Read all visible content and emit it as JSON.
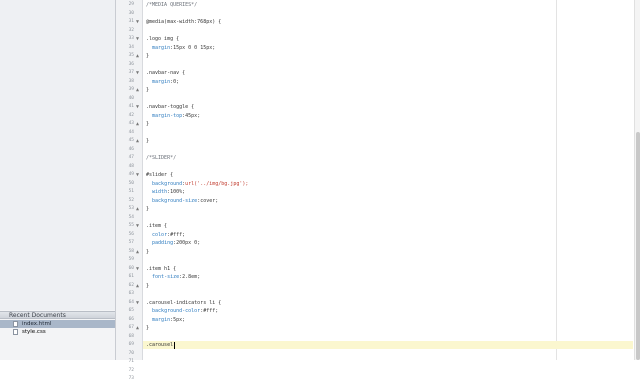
{
  "sidebar": {
    "header": "Recent Documents",
    "documents": [
      {
        "name": "index.html",
        "selected": true
      },
      {
        "name": "style.css",
        "selected": false
      }
    ]
  },
  "editor": {
    "lines": [
      {
        "n": "29",
        "text": "/*MEDIA QUERIES*/",
        "kind": "comment"
      },
      {
        "n": "30",
        "text": ""
      },
      {
        "n": "31",
        "text": "@media(max-width:768px) {",
        "fold": "▼"
      },
      {
        "n": "32",
        "text": ""
      },
      {
        "n": "33",
        "text": ".logo img {",
        "fold": "▼"
      },
      {
        "n": "34",
        "text": "  margin:15px 0 0 15px;"
      },
      {
        "n": "35",
        "text": "}",
        "fold": "▲"
      },
      {
        "n": "36",
        "text": ""
      },
      {
        "n": "37",
        "text": ".navbar-nav {",
        "fold": "▼"
      },
      {
        "n": "38",
        "text": "  margin:0;"
      },
      {
        "n": "39",
        "text": "}",
        "fold": "▲"
      },
      {
        "n": "40",
        "text": ""
      },
      {
        "n": "41",
        "text": ".navbar-toggle {",
        "fold": "▼"
      },
      {
        "n": "42",
        "text": "  margin-top:45px;"
      },
      {
        "n": "43",
        "text": "}",
        "fold": "▲"
      },
      {
        "n": "44",
        "text": ""
      },
      {
        "n": "45",
        "text": "}",
        "fold": "▲"
      },
      {
        "n": "46",
        "text": ""
      },
      {
        "n": "47",
        "text": "/*SLIDER*/",
        "kind": "comment"
      },
      {
        "n": "48",
        "text": ""
      },
      {
        "n": "49",
        "text": "#slider {",
        "fold": "▼"
      },
      {
        "n": "50",
        "text": "  background:url('../img/bg.jpg');",
        "kind": "string"
      },
      {
        "n": "51",
        "text": "  width:100%;"
      },
      {
        "n": "52",
        "text": "  background-size:cover;"
      },
      {
        "n": "53",
        "text": "}",
        "fold": "▲"
      },
      {
        "n": "54",
        "text": ""
      },
      {
        "n": "55",
        "text": ".item {",
        "fold": "▼"
      },
      {
        "n": "56",
        "text": "  color:#fff;"
      },
      {
        "n": "57",
        "text": "  padding:200px 0;"
      },
      {
        "n": "58",
        "text": "}",
        "fold": "▲"
      },
      {
        "n": "59",
        "text": ""
      },
      {
        "n": "60",
        "text": ".item h1 {",
        "fold": "▼"
      },
      {
        "n": "61",
        "text": "  font-size:2.8em;"
      },
      {
        "n": "62",
        "text": "}",
        "fold": "▲"
      },
      {
        "n": "63",
        "text": ""
      },
      {
        "n": "64",
        "text": ".carousel-indicators li {",
        "fold": "▼"
      },
      {
        "n": "65",
        "text": "  background-color:#fff;"
      },
      {
        "n": "66",
        "text": "  margin:5px;"
      },
      {
        "n": "67",
        "text": "}",
        "fold": "▲"
      },
      {
        "n": "68",
        "text": ""
      },
      {
        "n": "69",
        "text": ".carousel",
        "current": true
      },
      {
        "n": "70",
        "text": ""
      },
      {
        "n": "71",
        "text": ""
      },
      {
        "n": "72",
        "text": ""
      },
      {
        "n": "73",
        "text": ""
      }
    ]
  }
}
